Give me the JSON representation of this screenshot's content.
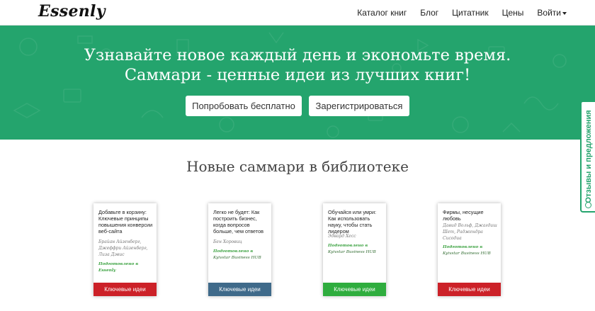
{
  "navbar": {
    "logo": "Essenly",
    "items": [
      {
        "label": "Каталог книг"
      },
      {
        "label": "Блог"
      },
      {
        "label": "Цитатник"
      },
      {
        "label": "Цены"
      },
      {
        "label": "Войти"
      }
    ]
  },
  "hero": {
    "line1": "Узнавайте новое каждый день и экономьте время.",
    "line2": "Саммари - ценные идеи из лучших книг!",
    "try_label": "Попробовать бесплатно",
    "register_label": "Зарегистрироваться",
    "background_color": "#24a46d"
  },
  "feedback": {
    "label": "Отзывы и предложения",
    "icon": "chat-bubble-icon"
  },
  "section": {
    "title": "Новые саммари в библиотеке"
  },
  "cards": [
    {
      "title": "Добавьте в корзину: Ключевые принципы повышения конверсии веб-сайта",
      "authors": "Брайан Айзенберг, Джеффри Айзенберг, Лиза Дэвис",
      "prepared": "Подготовлено в",
      "prepared_by": "Essenly",
      "button": "Ключевые идеи",
      "button_color": "#cc2128"
    },
    {
      "title": "Легко не будет: Как построить бизнес, когда вопросов больше, чем ответов",
      "authors": "Бен Хоровиц",
      "prepared": "Подготовлено в",
      "prepared_by": "Kyivstar Business HUB",
      "button": "Ключевые идеи",
      "button_color": "#3f6a8a"
    },
    {
      "title": "Обучайся или умри: Как использовать науку, чтобы стать лидером",
      "authors": "Эдвард Хесс",
      "prepared": "Подготовлено в",
      "prepared_by": "Kyivstar Business HUB",
      "button": "Ключевые идеи",
      "button_color": "#2fad3e"
    },
    {
      "title": "Фирмы, несущие любовь",
      "authors": "Давид Вольф, Джагдиш Шет, Раджендра Сисодиа",
      "prepared": "Подготовлено в",
      "prepared_by": "Kyivstar Business HUB",
      "button": "Ключевые идеи",
      "button_color": "#cc2128"
    }
  ]
}
